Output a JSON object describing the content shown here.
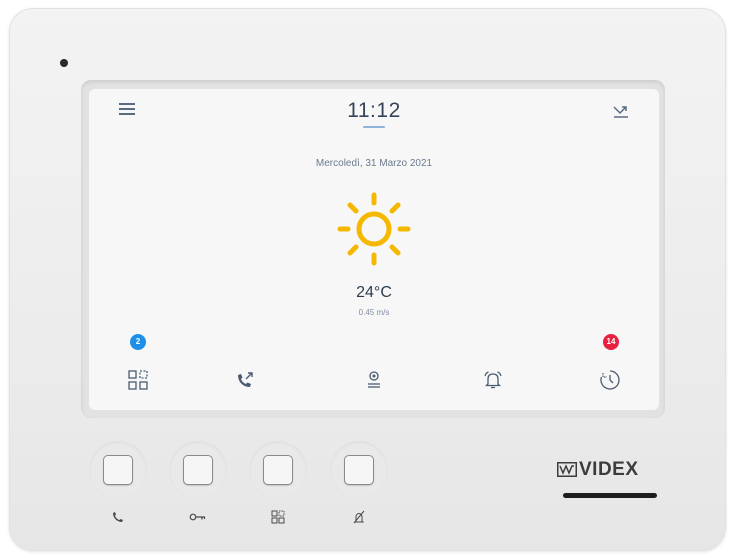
{
  "screen": {
    "time": "11:12",
    "date": "Mercoledì, 31 Marzo 2021",
    "weather": {
      "icon": "sun-icon",
      "temperature": "24°C",
      "wind": "0.45 m/s",
      "color": "#f5b800"
    },
    "top_bar": {
      "left_icon": "menu-icon",
      "right_icon": "missed-call-icon"
    },
    "dock": [
      {
        "name": "qr-code-icon",
        "badge": "2",
        "badge_color": "#1e8fe8"
      },
      {
        "name": "outgoing-call-icon"
      },
      {
        "name": "user-location-icon"
      },
      {
        "name": "alarm-bell-icon"
      },
      {
        "name": "history-clock-icon",
        "badge": "14",
        "badge_color": "#e8213f"
      }
    ]
  },
  "hardware_buttons": [
    {
      "icon": "phone-icon"
    },
    {
      "icon": "key-icon"
    },
    {
      "icon": "qr-code-icon"
    },
    {
      "icon": "mute-microphone-icon"
    }
  ],
  "brand": {
    "name": "VIDEX"
  }
}
